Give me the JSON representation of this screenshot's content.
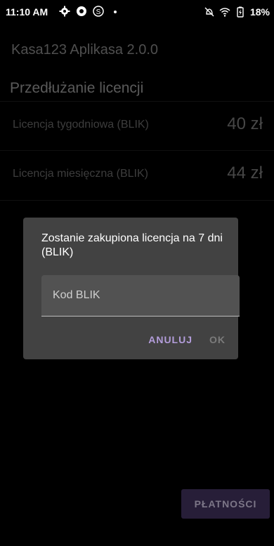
{
  "status_bar": {
    "time": "11:10 AM",
    "battery_percent": "18%",
    "left_icons": [
      "gear-icon",
      "chrome-icon",
      "s-icon",
      "dot-icon"
    ],
    "right_icons": [
      "alarm-off-icon",
      "wifi-icon",
      "battery-charging-icon"
    ]
  },
  "app": {
    "title": "Kasa123 Aplikasa 2.0.0",
    "section_title": "Przedłużanie licencji",
    "licenses": [
      {
        "name": "Licencja tygodniowa (BLIK)",
        "price": "40 zł"
      },
      {
        "name": "Licencja miesięczna (BLIK)",
        "price": "44 zł"
      }
    ],
    "pay_button": "PŁATNOŚCI"
  },
  "dialog": {
    "message": "Zostanie zakupiona licencja na 7 dni (BLIK)",
    "input_placeholder": "Kod BLIK",
    "input_value": "",
    "cancel_label": "ANULUJ",
    "ok_label": "OK"
  },
  "colors": {
    "accent": "#b39ddb",
    "dialog_bg": "#424242",
    "pay_button_bg": "#3d2e57"
  }
}
